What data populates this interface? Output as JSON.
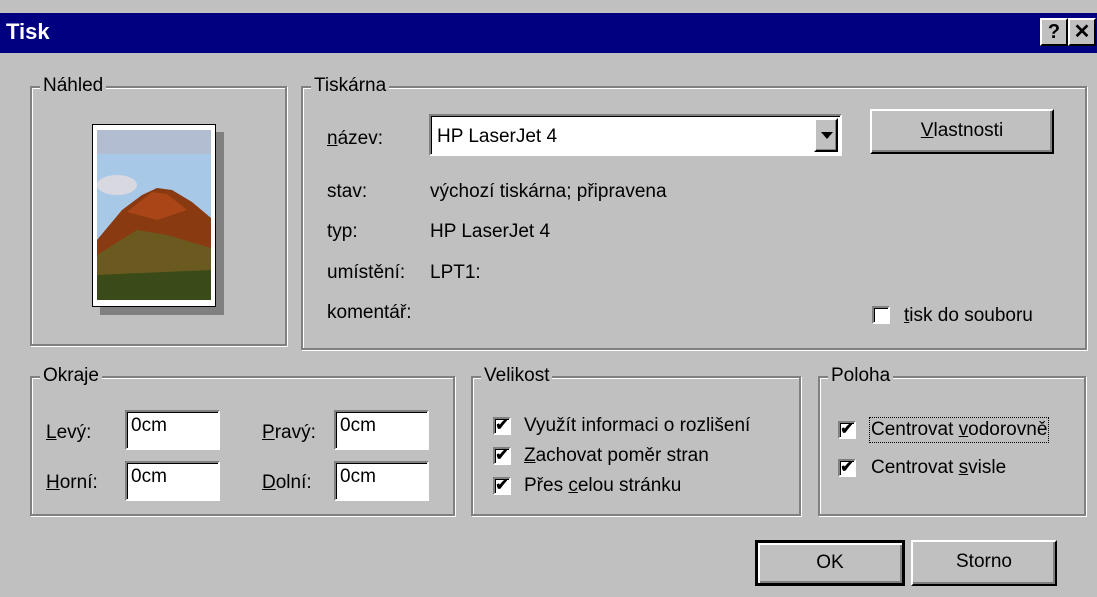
{
  "window": {
    "title": "Tisk",
    "help_glyph": "?",
    "close_glyph": "✕"
  },
  "preview": {
    "legend": "Náhled"
  },
  "printer": {
    "legend": "Tiskárna",
    "name_label_acc": "n",
    "name_label_rest": "ázev:",
    "name_value": "HP LaserJet 4",
    "properties_acc": "V",
    "properties_rest": "lastnosti",
    "status_label": "stav:",
    "status_value": "výchozí tiskárna; připravena",
    "type_label": "typ:",
    "type_value": "HP LaserJet 4",
    "location_label": "umístění:",
    "location_value": "LPT1:",
    "comment_label": "komentář:",
    "print_to_file_acc": "t",
    "print_to_file_rest": "isk do souboru",
    "print_to_file_checked": false
  },
  "margins": {
    "legend": "Okraje",
    "left_acc": "L",
    "left_rest": "evý:",
    "left_value": "0cm",
    "right_acc": "P",
    "right_rest": "ravý:",
    "right_value": "0cm",
    "top_acc": "H",
    "top_rest": "orní:",
    "top_value": "0cm",
    "bottom_acc": "D",
    "bottom_rest": "olní:",
    "bottom_value": "0cm"
  },
  "size": {
    "legend": "Velikost",
    "use_resolution": "Využít informaci o rozlišení",
    "keep_ratio_acc": "Z",
    "keep_ratio_rest": "achovat poměr stran",
    "full_page_pre": "Přes ",
    "full_page_acc": "c",
    "full_page_rest": "elou stránku",
    "check_mark": "✔"
  },
  "position": {
    "legend": "Poloha",
    "center_h_pre": "Centrovat ",
    "center_h_acc": "v",
    "center_h_rest": "odorovně",
    "center_v_pre": "Centrovat ",
    "center_v_acc": "s",
    "center_v_rest": "visle"
  },
  "buttons": {
    "ok": "OK",
    "cancel": "Storno"
  }
}
